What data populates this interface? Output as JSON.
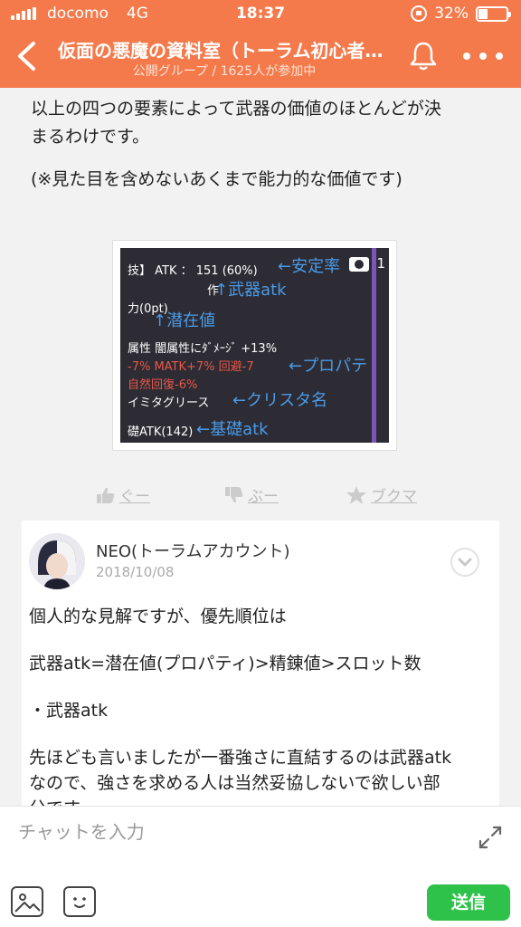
{
  "status_bar": {
    "carrier": "docomo",
    "network": "4G",
    "time": "18:37",
    "battery": "32%",
    "battery_level": 0.32
  },
  "header": {
    "title": "仮面の悪魔の資料室（トーラム初心者…",
    "subtitle": "公開グループ / 1625人が参加中"
  },
  "post": {
    "paragraph1_line1": "以上の四つの要素によって武器の価値のほとんどが決",
    "paragraph1_line2": "まるわけです。",
    "paragraph2": "(※見た目を含めないあくまで能力的な価値です)",
    "image": {
      "photo_count": "1",
      "lines": [
        "技】 ATK ： 151 (60%)",
        "作",
        "力(0pt)",
        "属性 闇属性にﾀﾞﾒｰｼﾞ +13%",
        "-7% MATK+7% 回避-7",
        "自然回復-6%",
        "イミタグリース",
        "礎ATK(142)"
      ],
      "annotations": [
        "←安定率",
        "↑武器atk",
        "↑潜在値",
        "←プロパテ",
        "←クリスタ名",
        "←基礎atk"
      ]
    }
  },
  "reactions": {
    "like": "ぐー",
    "dislike": "ぶー",
    "bookmark": "ブクマ"
  },
  "comment": {
    "author": "NEO(トーラムアカウント)",
    "date": "2018/10/08",
    "lines": [
      "個人的な見解ですが、優先順位は",
      "武器atk=潜在値(プロパティ)>精錬値>スロット数",
      "・武器atk",
      "先ほども言いましたが一番強さに直結するのは武器atk",
      "なので、強さを求める人は当然妥協しないで欲しい部",
      "分です。"
    ]
  },
  "composer": {
    "placeholder": "チャットを入力",
    "send_label": "送信"
  },
  "colors": {
    "header": "#f47a4c",
    "send": "#2ec24b",
    "annotation": "#4a9be8"
  }
}
